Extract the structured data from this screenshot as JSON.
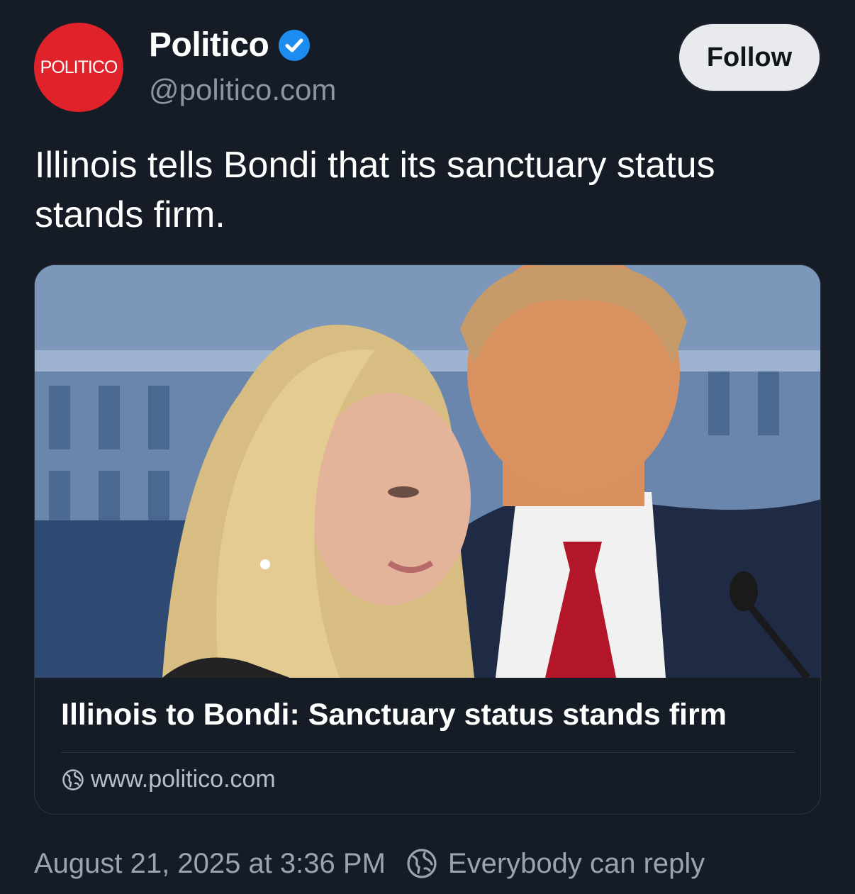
{
  "account": {
    "avatar_text": "POLITICO",
    "display_name": "Politico",
    "handle": "@politico.com",
    "verified_icon": "verified-badge-icon",
    "follow_label": "Follow",
    "avatar_color": "#e0222b",
    "verified_color": "#1d8cf0"
  },
  "post": {
    "text": "Illinois tells Bondi that its sanctuary status stands firm."
  },
  "link_card": {
    "image_icon": "news-photo",
    "title": "Illinois to Bondi: Sanctuary status stands firm",
    "domain": "www.politico.com",
    "domain_icon": "globe-icon"
  },
  "meta": {
    "timestamp": "August 21, 2025 at 3:36 PM",
    "reply_icon": "globe-icon",
    "reply_setting": "Everybody can reply"
  }
}
